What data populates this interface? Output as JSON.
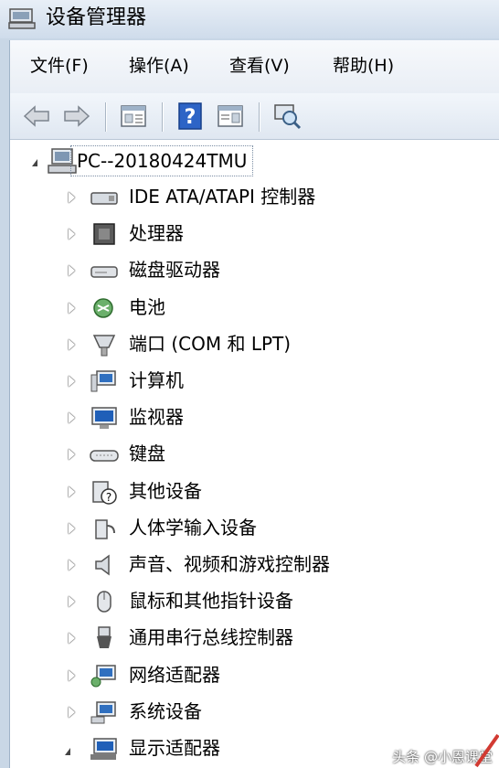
{
  "window": {
    "title": "设备管理器"
  },
  "menu": {
    "items": [
      {
        "label": "文件(F)"
      },
      {
        "label": "操作(A)"
      },
      {
        "label": "查看(V)"
      },
      {
        "label": "帮助(H)"
      }
    ]
  },
  "toolbar": {
    "buttons": [
      {
        "icon": "back-arrow-icon"
      },
      {
        "icon": "forward-arrow-icon"
      },
      {
        "icon": "properties-icon"
      },
      {
        "icon": "help-icon"
      },
      {
        "icon": "view-icon"
      },
      {
        "icon": "scan-hardware-icon"
      }
    ]
  },
  "tree": {
    "root": {
      "label": "PC--20180424TMU",
      "icon": "computer-icon"
    },
    "items": [
      {
        "label": "IDE ATA/ATAPI 控制器",
        "icon": "ide-controller-icon"
      },
      {
        "label": "处理器",
        "icon": "processor-icon"
      },
      {
        "label": "磁盘驱动器",
        "icon": "disk-drive-icon"
      },
      {
        "label": "电池",
        "icon": "battery-icon"
      },
      {
        "label": "端口 (COM 和 LPT)",
        "icon": "port-icon"
      },
      {
        "label": "计算机",
        "icon": "computer-icon"
      },
      {
        "label": "监视器",
        "icon": "monitor-icon"
      },
      {
        "label": "键盘",
        "icon": "keyboard-icon"
      },
      {
        "label": "其他设备",
        "icon": "unknown-device-icon"
      },
      {
        "label": "人体学输入设备",
        "icon": "hid-icon"
      },
      {
        "label": "声音、视频和游戏控制器",
        "icon": "speaker-icon"
      },
      {
        "label": "鼠标和其他指针设备",
        "icon": "mouse-icon"
      },
      {
        "label": "通用串行总线控制器",
        "icon": "usb-icon"
      },
      {
        "label": "网络适配器",
        "icon": "network-adapter-icon"
      },
      {
        "label": "系统设备",
        "icon": "system-device-icon"
      },
      {
        "label": "显示适配器",
        "icon": "display-adapter-icon"
      }
    ]
  },
  "watermark": "头条 @小恩课堂"
}
